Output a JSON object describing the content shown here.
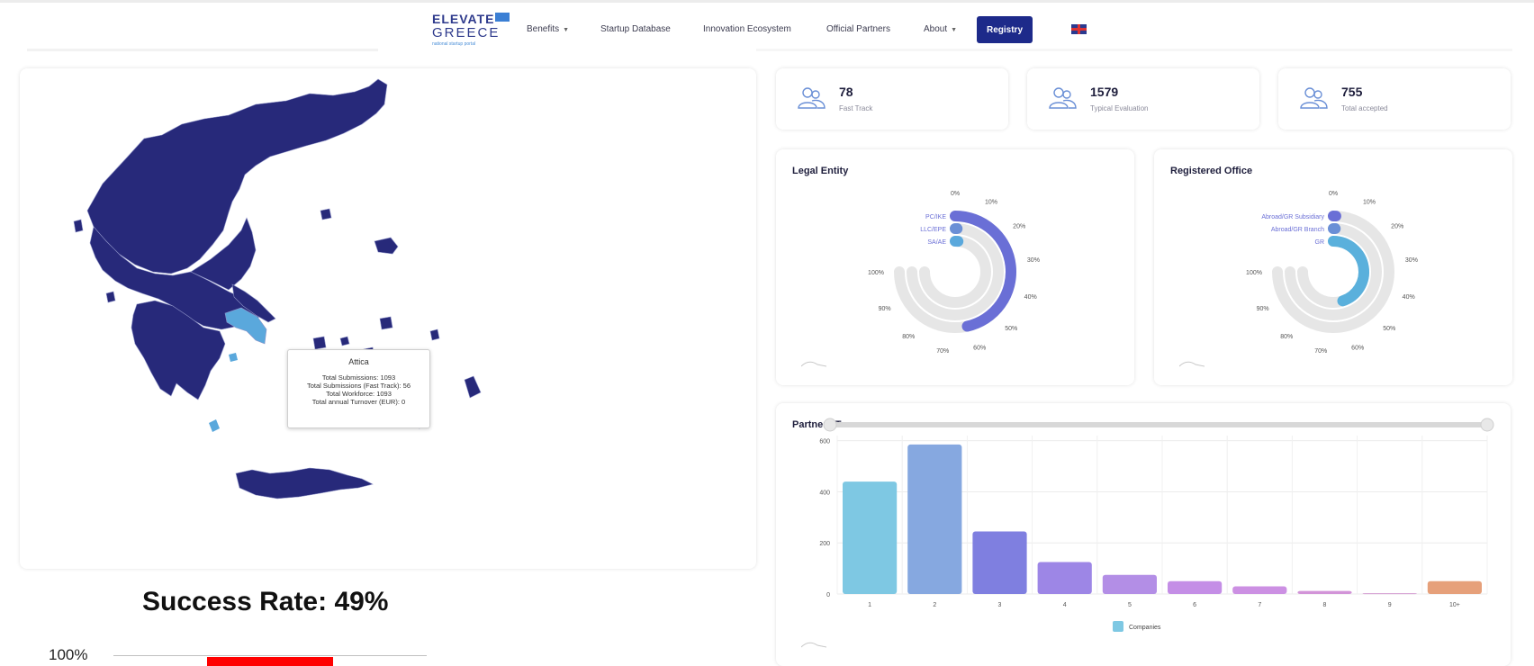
{
  "navbar": {
    "logo": {
      "line1": "ELEVATE",
      "line2": "GREECE",
      "line3": "national startup portal"
    },
    "items": [
      {
        "label": "Benefits",
        "has_caret": true
      },
      {
        "label": "Startup Database",
        "has_caret": false
      },
      {
        "label": "Innovation Ecosystem",
        "has_caret": false
      },
      {
        "label": "Official Partners",
        "has_caret": false
      },
      {
        "label": "About",
        "has_caret": true
      }
    ],
    "registry_label": "Registry",
    "language_icon": "uk-flag-icon"
  },
  "stats": [
    {
      "value": "78",
      "label": "Fast Track",
      "icon": "users-icon"
    },
    {
      "value": "1579",
      "label": "Typical Evaluation",
      "icon": "users-icon"
    },
    {
      "value": "755",
      "label": "Total accepted",
      "icon": "users-icon"
    }
  ],
  "map": {
    "tooltip": {
      "title": "Attica",
      "lines": [
        "Total Submissions: 1093",
        "Total Submissions (Fast Track): 56",
        "Total Workforce: 1093",
        "Total annual Turnover (EUR): 0"
      ]
    },
    "colors": {
      "region": "#27297a",
      "highlight": "#5aa8dc",
      "border": "#8f94c8"
    }
  },
  "legal_entity": {
    "title": "Legal Entity",
    "chart_data": {
      "type": "radialBar",
      "series": [
        {
          "name": "PC/IKE",
          "value": 62,
          "color": "#6a6fd6"
        },
        {
          "name": "LLC/EPE",
          "value": 1,
          "color": "#6a8fd6"
        },
        {
          "name": "SA/AE",
          "value": 2,
          "color": "#5aa8dc"
        }
      ],
      "ticks": [
        "0%",
        "10%",
        "20%",
        "30%",
        "40%",
        "50%",
        "60%",
        "70%",
        "80%",
        "90%",
        "100%"
      ],
      "track_color": "#e6e6e6"
    }
  },
  "registered_office": {
    "title": "Registered Office",
    "chart_data": {
      "type": "radialBar",
      "series": [
        {
          "name": "Abroad/GR Subsidiary",
          "value": 1,
          "color": "#6a6fd6"
        },
        {
          "name": "Abroad/GR Branch",
          "value": 1,
          "color": "#6a8fd6"
        },
        {
          "name": "GR",
          "value": 60,
          "color": "#5ab0dc"
        }
      ],
      "ticks": [
        "0%",
        "10%",
        "20%",
        "30%",
        "40%",
        "50%",
        "60%",
        "70%",
        "80%",
        "90%",
        "100%"
      ],
      "track_color": "#e6e6e6"
    }
  },
  "partners_team": {
    "title": "Partners/Team",
    "chart_data": {
      "type": "bar",
      "categories": [
        "1",
        "2",
        "3",
        "4",
        "5",
        "6",
        "7",
        "8",
        "9",
        "10+"
      ],
      "series": [
        {
          "name": "Companies",
          "values": [
            440,
            585,
            245,
            125,
            75,
            50,
            30,
            12,
            3,
            50
          ]
        }
      ],
      "bar_colors": [
        "#7ec8e3",
        "#86a8e0",
        "#7f7fe0",
        "#9d86e6",
        "#b38ee6",
        "#c48ee6",
        "#cc90e3",
        "#d294d8",
        "#d29ad0",
        "#e6a07a"
      ],
      "yticks": [
        "0",
        "200",
        "400",
        "600"
      ],
      "ylim": [
        0,
        620
      ],
      "legend": "bottom-center"
    }
  },
  "success_rate": {
    "title": "Success Rate: 49%",
    "axis_label": "100%",
    "color": "#ff0000"
  }
}
